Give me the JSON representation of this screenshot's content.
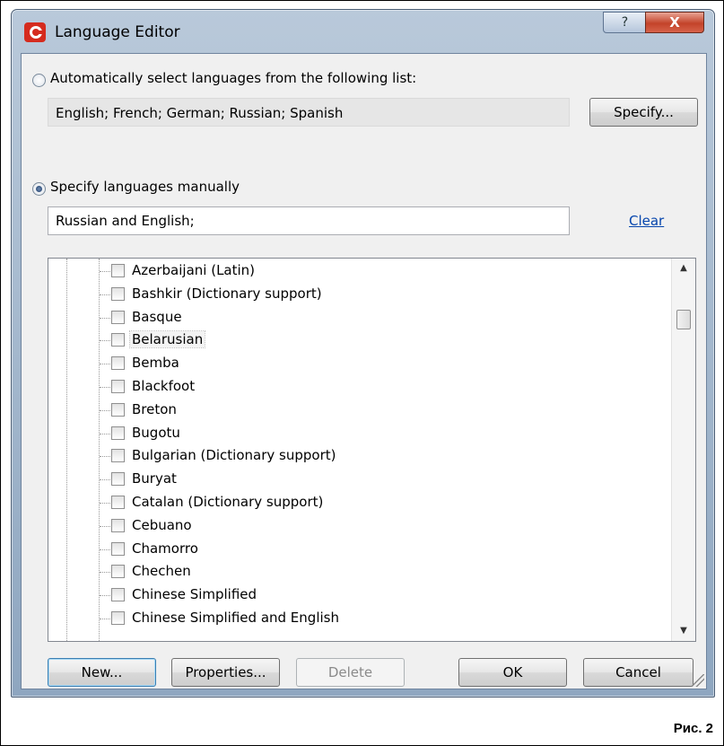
{
  "window": {
    "title": "Language Editor",
    "help_label": "?",
    "close_label": "X"
  },
  "auto_select": {
    "label": "Automatically select languages from the following list:",
    "selected": false,
    "value": "English; French; German; Russian; Spanish",
    "specify_label": "Specify..."
  },
  "manual_select": {
    "label": "Specify languages manually",
    "selected": true,
    "value": "Russian and English;",
    "clear_label": "Clear"
  },
  "language_list": {
    "items": [
      {
        "label": "Azerbaijani (Latin)",
        "checked": false
      },
      {
        "label": "Bashkir (Dictionary support)",
        "checked": false
      },
      {
        "label": "Basque",
        "checked": false
      },
      {
        "label": "Belarusian",
        "checked": false,
        "focused": true
      },
      {
        "label": "Bemba",
        "checked": false
      },
      {
        "label": "Blackfoot",
        "checked": false
      },
      {
        "label": "Breton",
        "checked": false
      },
      {
        "label": "Bugotu",
        "checked": false
      },
      {
        "label": "Bulgarian (Dictionary support)",
        "checked": false
      },
      {
        "label": "Buryat",
        "checked": false
      },
      {
        "label": "Catalan (Dictionary support)",
        "checked": false
      },
      {
        "label": "Cebuano",
        "checked": false
      },
      {
        "label": "Chamorro",
        "checked": false
      },
      {
        "label": "Chechen",
        "checked": false
      },
      {
        "label": "Chinese Simplified",
        "checked": false
      },
      {
        "label": "Chinese Simplified and English",
        "checked": false
      }
    ],
    "scroll_up_icon": "triangle-up",
    "scroll_down_icon": "triangle-down"
  },
  "buttons": {
    "new": "New...",
    "properties": "Properties...",
    "delete": "Delete",
    "ok": "OK",
    "cancel": "Cancel"
  },
  "caption": "Рис. 2"
}
